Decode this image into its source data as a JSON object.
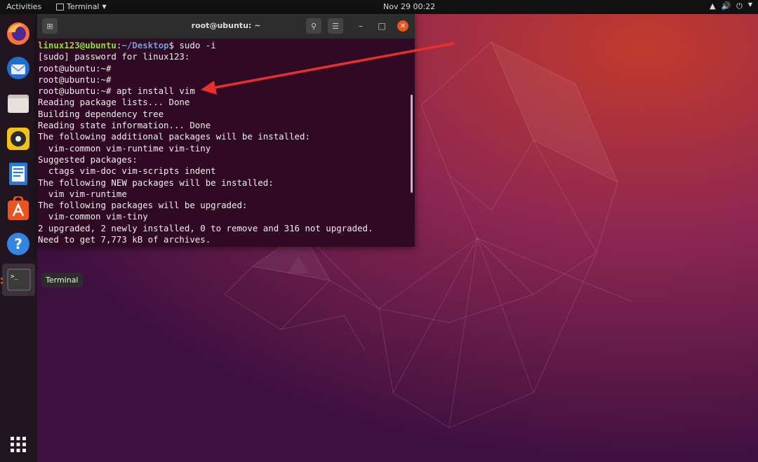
{
  "topbar": {
    "activities": "Activities",
    "app_menu": "Terminal",
    "clock": "Nov 29  00:22"
  },
  "dock": {
    "items": [
      {
        "name": "Firefox",
        "icon": "firefox-icon"
      },
      {
        "name": "Thunderbird",
        "icon": "thunderbird-icon"
      },
      {
        "name": "Files",
        "icon": "files-icon"
      },
      {
        "name": "Rhythmbox",
        "icon": "rhythmbox-icon"
      },
      {
        "name": "LibreOffice Writer",
        "icon": "writer-icon"
      },
      {
        "name": "Ubuntu Software",
        "icon": "software-icon"
      },
      {
        "name": "Help",
        "icon": "help-icon"
      },
      {
        "name": "Terminal",
        "icon": "terminal-icon"
      }
    ],
    "tooltip": "Terminal",
    "apps_grid_icon": "apps-grid-icon"
  },
  "terminal": {
    "title": "root@ubuntu: ~",
    "prompt_user": "linux123@ubuntu",
    "prompt_sep": ":",
    "prompt_path": "~/Desktop",
    "prompt_sign": "$",
    "first_cmd": " sudo -i",
    "lines": [
      "[sudo] password for linux123:",
      "root@ubuntu:~#",
      "root@ubuntu:~#",
      "root@ubuntu:~# apt install vim",
      "Reading package lists... Done",
      "Building dependency tree",
      "Reading state information... Done",
      "The following additional packages will be installed:",
      "  vim-common vim-runtime vim-tiny",
      "Suggested packages:",
      "  ctags vim-doc vim-scripts indent",
      "The following NEW packages will be installed:",
      "  vim vim-runtime",
      "The following packages will be upgraded:",
      "  vim-common vim-tiny",
      "2 upgraded, 2 newly installed, 0 to remove and 316 not upgraded.",
      "Need to get 7,773 kB of archives."
    ]
  },
  "colors": {
    "accent": "#e95420",
    "terminal_bg": "#300a24",
    "arrow": "#e8302a"
  }
}
